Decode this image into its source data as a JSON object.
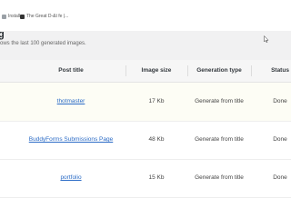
{
  "bookmarks": [
    {
      "label": "Install",
      "icon": "page-icon"
    },
    {
      "label": "The Great D-&t fe |...",
      "icon": "page-icon"
    }
  ],
  "header": {
    "title": "g",
    "description": "ows the last 100 generated images."
  },
  "table": {
    "columns": [
      "Post title",
      "Image size",
      "Generation type",
      "Status"
    ],
    "rows": [
      {
        "post_title": "thotmaster",
        "image_size": "17 Kb",
        "generation_type": "Generate from title",
        "status": "Done"
      },
      {
        "post_title": "BuddyForms Submissions Page",
        "image_size": "48 Kb",
        "generation_type": "Generate from title",
        "status": "Done"
      },
      {
        "post_title": "portfolio",
        "image_size": "15 Kb",
        "generation_type": "Generate from title",
        "status": "Done"
      }
    ]
  },
  "colors": {
    "link": "#2b6bc6",
    "header_bg": "#f1f1f2",
    "row_highlight": "#fdfdf5"
  }
}
